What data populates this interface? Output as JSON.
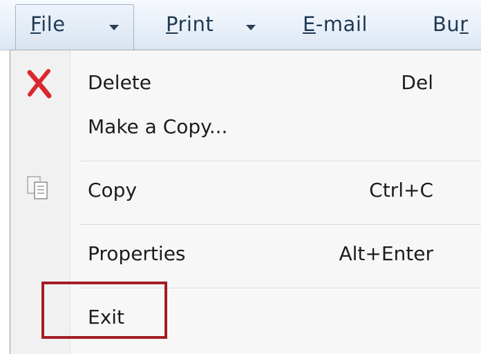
{
  "toolbar": {
    "file": {
      "accel": "F",
      "rest": "ile"
    },
    "print": {
      "accel": "P",
      "rest": "rint"
    },
    "email": {
      "accel": "E",
      "rest": "-mail"
    },
    "burn": {
      "pre": "Bu",
      "accel": "r"
    }
  },
  "menu": {
    "items": [
      {
        "label": "Delete",
        "shortcut": "Del",
        "icon": "delete-x-icon"
      },
      {
        "label": "Make a Copy...",
        "shortcut": "",
        "icon": ""
      },
      {
        "label": "Copy",
        "shortcut": "Ctrl+C",
        "icon": "copy-icon"
      },
      {
        "label": "Properties",
        "shortcut": "Alt+Enter",
        "icon": ""
      },
      {
        "label": "Exit",
        "shortcut": "",
        "icon": ""
      }
    ]
  },
  "colors": {
    "toolbar_text": "#1e3954",
    "delete_icon": "#d9282f",
    "highlight_box": "#a31d24",
    "menu_bg": "#f7f7f7"
  }
}
